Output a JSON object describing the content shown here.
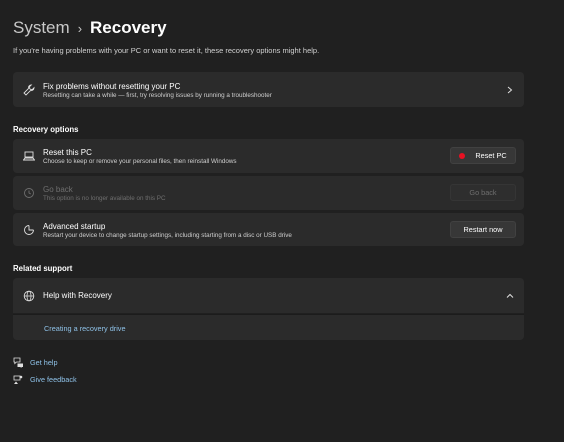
{
  "breadcrumb": {
    "parent": "System",
    "separator": "›",
    "current": "Recovery"
  },
  "intro": "If you're having problems with your PC or want to reset it, these recovery options might help.",
  "fix_card": {
    "title": "Fix problems without resetting your PC",
    "subtitle": "Resetting can take a while — first, try resolving issues by running a troubleshooter"
  },
  "recovery_options": {
    "heading": "Recovery options",
    "items": [
      {
        "title": "Reset this PC",
        "subtitle": "Choose to keep or remove your personal files, then reinstall Windows",
        "button": "Reset PC",
        "enabled": true
      },
      {
        "title": "Go back",
        "subtitle": "This option is no longer available on this PC",
        "button": "Go back",
        "enabled": false
      },
      {
        "title": "Advanced startup",
        "subtitle": "Restart your device to change startup settings, including starting from a disc or USB drive",
        "button": "Restart now",
        "enabled": true
      }
    ]
  },
  "related_support": {
    "heading": "Related support",
    "expander_title": "Help with Recovery",
    "link": "Creating a recovery drive"
  },
  "footer": {
    "get_help": "Get help",
    "give_feedback": "Give feedback"
  },
  "colors": {
    "background": "#202020",
    "card": "#2b2b2b",
    "link": "#8fc2e8",
    "reset_dot": "#e81123"
  },
  "icons": [
    "chevron-right-icon",
    "wrench-icon",
    "reset-pc-icon",
    "history-icon",
    "advanced-startup-icon",
    "globe-icon",
    "chevron-up-icon",
    "help-icon",
    "feedback-icon"
  ]
}
